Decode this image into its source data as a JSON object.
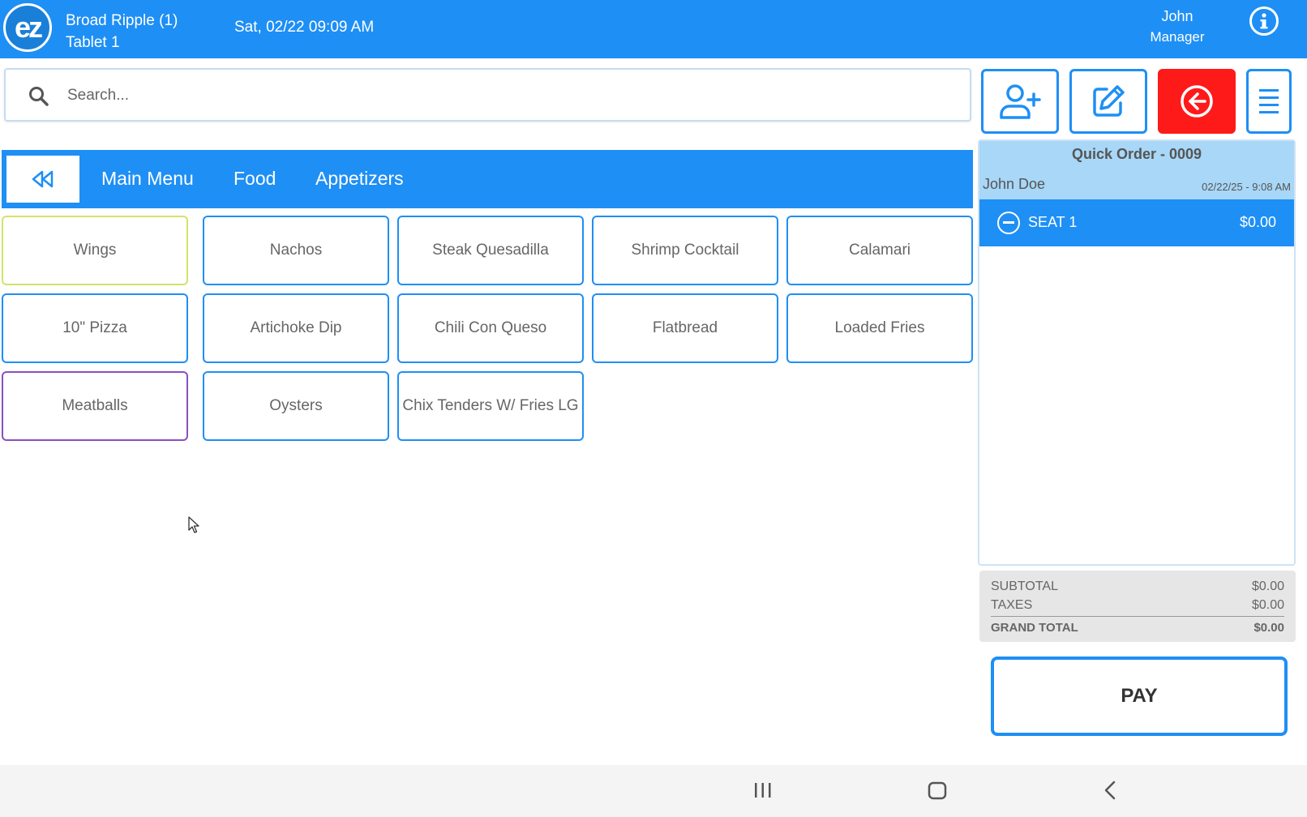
{
  "header": {
    "logo_text": "ez",
    "location": "Broad Ripple (1)",
    "device": "Tablet 1",
    "datetime": "Sat, 02/22 09:09 AM",
    "user_name": "John",
    "user_role": "Manager",
    "info_icon": "info-icon",
    "color": "#1e8ff5"
  },
  "search": {
    "placeholder": "Search...",
    "value": ""
  },
  "actions": [
    {
      "icon": "add-user-icon"
    },
    {
      "icon": "edit-icon"
    },
    {
      "icon": "back-circle-icon",
      "color": "#ff1a1a"
    },
    {
      "icon": "menu-icon"
    }
  ],
  "breadcrumb": {
    "back_icon": "rewind-icon",
    "items": [
      "Main Menu",
      "Food",
      "Appetizers"
    ]
  },
  "menu_items": [
    {
      "label": "Wings",
      "border": "#d3e36a"
    },
    {
      "label": "Nachos",
      "border": "#1e8ff5"
    },
    {
      "label": "Steak Quesadilla",
      "border": "#1e8ff5"
    },
    {
      "label": "Shrimp Cocktail",
      "border": "#1e8ff5"
    },
    {
      "label": "Calamari",
      "border": "#1e8ff5"
    },
    {
      "label": "10\" Pizza",
      "border": "#1e8ff5"
    },
    {
      "label": "Artichoke Dip",
      "border": "#1e8ff5"
    },
    {
      "label": "Chili Con Queso",
      "border": "#1e8ff5"
    },
    {
      "label": "Flatbread",
      "border": "#1e8ff5"
    },
    {
      "label": "Loaded Fries",
      "border": "#1e8ff5"
    },
    {
      "label": "Meatballs",
      "border": "#8a4fbf"
    },
    {
      "label": "Oysters",
      "border": "#1e8ff5"
    },
    {
      "label": "Chix Tenders W/ Fries LG",
      "border": "#1e8ff5"
    }
  ],
  "order": {
    "title": "Quick Order - 0009",
    "customer": "John Doe",
    "time": "02/22/25 - 9:08 AM",
    "seat": {
      "label": "SEAT 1",
      "amount": "$0.00",
      "icon": "minus-circle-icon"
    }
  },
  "totals": {
    "subtotal_label": "SUBTOTAL",
    "subtotal": "$0.00",
    "taxes_label": "TAXES",
    "taxes": "$0.00",
    "grand_label": "GRAND TOTAL",
    "grand": "$0.00"
  },
  "pay_label": "PAY",
  "navbar": {
    "recent_icon": "recent-apps-icon",
    "home_icon": "home-icon",
    "back_icon": "back-icon"
  }
}
